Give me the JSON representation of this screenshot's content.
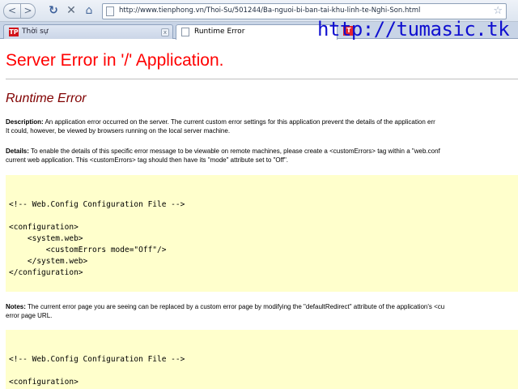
{
  "toolbar": {
    "back_label": "<",
    "forward_label": ">",
    "url": "http://www.tienphong.vn/Thoi-Su/501244/Ba-nguoi-bi-ban-tai-khu-linh-te-Nghi-Son.html"
  },
  "tabs": [
    {
      "label": "Thời sự",
      "favicon": "TP",
      "active": false
    },
    {
      "label": "Runtime Error",
      "active": true
    }
  ],
  "watermark": {
    "text": "http://tumasic.tk",
    "color": "#1010d0"
  },
  "page": {
    "title": "Server Error in '/' Application.",
    "subtitle": "Runtime Error",
    "description_label": "Description:",
    "description_line1": " An application error occurred on the server. The current custom error settings for this application prevent the details of the application err",
    "description_line2": "It could, however, be viewed by browsers running on the local server machine.",
    "details_label": "Details:",
    "details_line1": " To enable the details of this specific error message to be viewable on remote machines, please create a <customErrors> tag within a \"web.conf",
    "details_line2": "current web application. This <customErrors> tag should then have its \"mode\" attribute set to \"Off\".",
    "code1": "<!-- Web.Config Configuration File -->\n\n<configuration>\n    <system.web>\n        <customErrors mode=\"Off\"/>\n    </system.web>\n</configuration>",
    "notes_label": "Notes:",
    "notes_line1": " The current error page you are seeing can be replaced by a custom error page by modifying the \"defaultRedirect\" attribute of the application's <cu",
    "notes_line2": "error page URL.",
    "code2": "<!-- Web.Config Configuration File -->\n\n<configuration>"
  },
  "colors": {
    "title": "#ff0000",
    "subtitle": "#800000",
    "code_bg": "#ffffcc"
  }
}
